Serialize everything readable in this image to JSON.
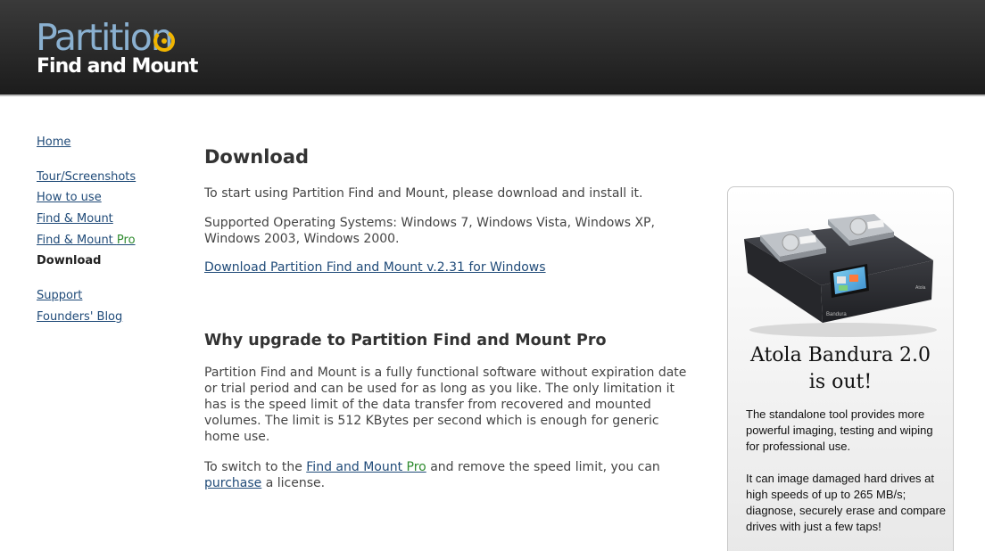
{
  "header": {
    "logo_top": "Partition",
    "logo_bottom": "Find and Mount",
    "colors": {
      "logo_blue": "#8ab0d0",
      "logo_ring": "#f0b400"
    }
  },
  "sidebar": {
    "items": [
      {
        "label": "Home"
      },
      {
        "label": "Tour/Screenshots"
      },
      {
        "label": "How to use"
      },
      {
        "label": "Find & Mount"
      },
      {
        "label": "Find & Mount ",
        "suffix": "Pro"
      },
      {
        "label": "Download",
        "current": true
      },
      {
        "label": "Support"
      },
      {
        "label": "Founders' Blog"
      }
    ]
  },
  "main": {
    "title": "Download",
    "intro": "To start using Partition Find and Mount, please download and install it.",
    "os_support": "Supported Operating Systems: Windows 7, Windows Vista, Windows XP, Windows 2003, Windows 2000.",
    "download_link": "Download Partition Find and Mount v.2.31 for Windows",
    "upgrade_title": "Why upgrade to Partition Find and Mount Pro",
    "upgrade_text": "Partition Find and Mount is a fully functional software without expiration date or trial period and can be used for as long as you like. The only limitation it has is the speed limit of the data transfer from recovered and mounted volumes. The limit is 512 KBytes per second which is enough for generic home use.",
    "switch_prefix": "To switch to the ",
    "switch_link": "Find and Mount ",
    "switch_link_pro": "Pro",
    "switch_middle": " and remove the speed limit, you can ",
    "purchase_link": "purchase",
    "switch_suffix": " a license."
  },
  "ad": {
    "product_label": "Bandura",
    "brand_label": "Atola",
    "title_line1": "Atola Bandura 2.0",
    "title_line2": "is out!",
    "para1": "The standalone tool provides more powerful imaging, testing and wiping for professional use.",
    "para2": "It can image damaged hard drives at high speeds of up to 265 MB/s; diagnose, securely erase and compare drives with just a few taps!"
  }
}
